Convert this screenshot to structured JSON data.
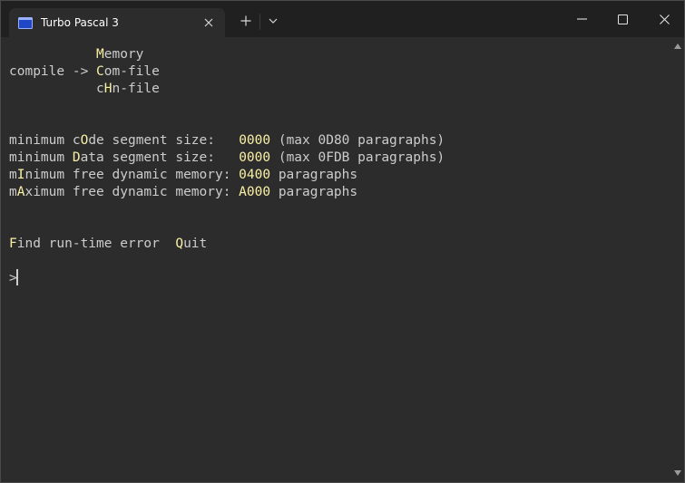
{
  "tab": {
    "title": "Turbo Pascal 3"
  },
  "terminal": {
    "lines": [
      {
        "segments": [
          {
            "t": "           "
          },
          {
            "t": "M",
            "hl": true
          },
          {
            "t": "emory"
          }
        ]
      },
      {
        "segments": [
          {
            "t": "compile -> "
          },
          {
            "t": "C",
            "hl": true
          },
          {
            "t": "om-file"
          }
        ]
      },
      {
        "segments": [
          {
            "t": "           c"
          },
          {
            "t": "H",
            "hl": true
          },
          {
            "t": "n-file"
          }
        ]
      },
      {
        "segments": [
          {
            "t": "minimum c"
          },
          {
            "t": "O",
            "hl": true
          },
          {
            "t": "de segment size:   "
          },
          {
            "t": "0000",
            "hl": true
          },
          {
            "t": " (max 0D80 paragraphs)"
          }
        ]
      },
      {
        "segments": [
          {
            "t": "minimum "
          },
          {
            "t": "D",
            "hl": true
          },
          {
            "t": "ata segment size:   "
          },
          {
            "t": "0000",
            "hl": true
          },
          {
            "t": " (max 0FDB paragraphs)"
          }
        ]
      },
      {
        "segments": [
          {
            "t": "m"
          },
          {
            "t": "I",
            "hl": true
          },
          {
            "t": "nimum free dynamic memory: "
          },
          {
            "t": "0400",
            "hl": true
          },
          {
            "t": " paragraphs"
          }
        ]
      },
      {
        "segments": [
          {
            "t": "m"
          },
          {
            "t": "A",
            "hl": true
          },
          {
            "t": "ximum free dynamic memory: "
          },
          {
            "t": "A000",
            "hl": true
          },
          {
            "t": " paragraphs"
          }
        ]
      },
      {
        "segments": [
          {
            "t": "F",
            "hl": true
          },
          {
            "t": "ind run-time error  "
          },
          {
            "t": "Q",
            "hl": true
          },
          {
            "t": "uit"
          }
        ]
      },
      {
        "segments": [
          {
            "t": ">"
          }
        ]
      }
    ]
  },
  "colors": {
    "background": "#2c2c2c",
    "text": "#cccccc",
    "highlight": "#f9f1a5",
    "titlebar": "#202020"
  }
}
